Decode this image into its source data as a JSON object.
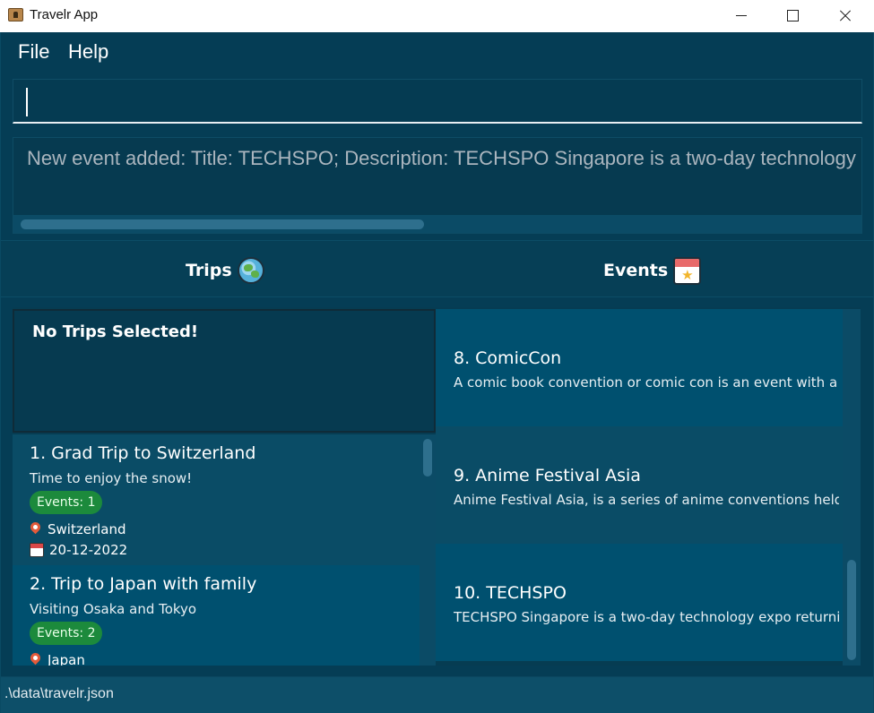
{
  "window": {
    "title": "Travelr App"
  },
  "menu": {
    "items": [
      "File",
      "Help"
    ]
  },
  "command": {
    "value": ""
  },
  "result": {
    "text": "New event added: Title: TECHSPO; Description: TECHSPO Singapore is a two-day technology expo retu"
  },
  "tabs": [
    {
      "label": "Trips",
      "icon": "globe-icon"
    },
    {
      "label": "Events",
      "icon": "calendar-star-icon"
    }
  ],
  "trip_panel": {
    "placeholder": "No Trips Selected!"
  },
  "trips": [
    {
      "title": "1.  Grad Trip to Switzerland",
      "description": "Time to enjoy the snow!",
      "events_badge": "Events: 1",
      "location": "Switzerland",
      "date": "20-12-2022"
    },
    {
      "title": "2.  Trip to Japan with family",
      "description": "Visiting Osaka and Tokyo",
      "events_badge": "Events: 2",
      "location": "Japan"
    }
  ],
  "events": [
    {
      "title": "8.  ComicCon",
      "description": "A comic book convention or comic con is an event with a ..."
    },
    {
      "title": "9.  Anime Festival Asia",
      "description": "Anime Festival Asia, is a series of anime conventions held i..."
    },
    {
      "title": "10.  TECHSPO",
      "description": "TECHSPO Singapore is a two-day technology expo returni..."
    }
  ],
  "status": {
    "file_path": ".\\data\\travelr.json"
  },
  "colors": {
    "background": "#053d55",
    "card_primary": "#00506f",
    "card_secondary": "#0a4c66",
    "badge_green": "#1c8a3c"
  }
}
